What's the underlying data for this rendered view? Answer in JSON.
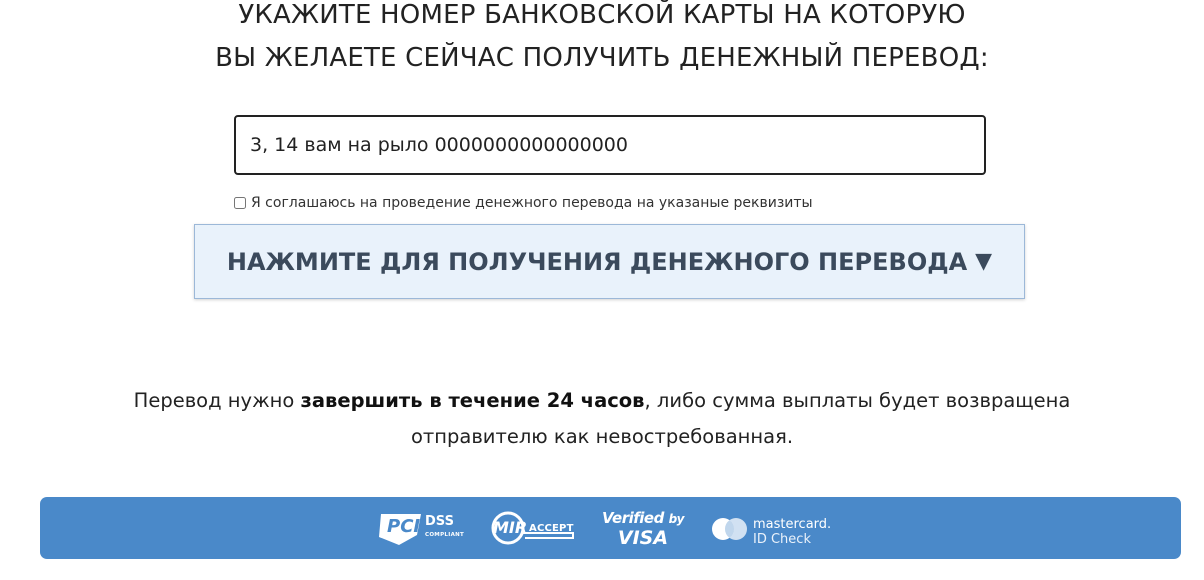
{
  "heading": {
    "line1": "УКАЖИТЕ НОМЕР БАНКОВСКОЙ КАРТЫ НА КОТОРУЮ",
    "line2": "ВЫ ЖЕЛАЕТЕ СЕЙЧАС ПОЛУЧИТЬ ДЕНЕЖНЫЙ ПЕРЕВОД:"
  },
  "card_field": {
    "value": "3, 14 вам на рыло 0000000000000000"
  },
  "agreement": {
    "checked": false,
    "label": "Я соглашаюсь на проведение денежного перевода на указаные реквизиты"
  },
  "cta": {
    "label": "НАЖМИТЕ ДЛЯ ПОЛУЧЕНИЯ ДЕНЕЖНОГО ПЕРЕВОДА",
    "arrow": "▼"
  },
  "notice": {
    "part1": "Перевод нужно ",
    "bold": "завершить в течение 24 часов",
    "part2": ", либо сумма выплаты будет возвращена отправителю как невостребованная."
  },
  "footer": {
    "background": "#4a89c9",
    "logos": {
      "pci": {
        "word": "PCI",
        "dss": "DSS",
        "compliant": "COMPLIANT"
      },
      "mir": {
        "word": "MIR",
        "accept": "ACCEPT"
      },
      "visa": {
        "line1": "Verified",
        "line1b": "by",
        "line2": "VISA"
      },
      "mastercard": {
        "word": "mastercard.",
        "sub": "ID Check"
      }
    }
  },
  "colors": {
    "cta_bg": "#e9f2fb",
    "cta_text": "#3b4a5c",
    "footer_bg": "#4a89c9"
  }
}
